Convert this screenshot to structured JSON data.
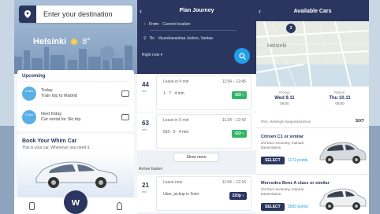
{
  "home": {
    "destination_placeholder": "Enter your destination",
    "city": "Helsinki",
    "temperature": "8°",
    "upcoming": {
      "title": "Upcoming",
      "items": [
        {
          "date": "2 Nov",
          "day": "Today",
          "text": "Train trip to Madrid"
        },
        {
          "date": "2 Nov",
          "day": "Next friday",
          "text": "Car rental for Ski trip"
        }
      ]
    },
    "book": {
      "title": "Book Your Whim Car",
      "subtitle": "This is your car, Whenever you need it."
    },
    "tabbar": {
      "center_label": "w"
    }
  },
  "plan": {
    "title": "Plan Journey",
    "from_label": "From:",
    "from_value": "Current location",
    "to_label": "To:",
    "to_value": "Vauxxkasashaa Jarkoo, Vantaa",
    "time_label": "Right now",
    "trips": [
      {
        "duration": "44",
        "unit": "min",
        "leave": "Leave in 4 min",
        "times": "11:54 – 12:45",
        "legs": "1 · 7 · 4 min",
        "action": "GO"
      },
      {
        "duration": "63",
        "unit": "min",
        "leave": "Leave in 5 min",
        "times": "11:24 – 12:42",
        "legs": "633 · 5 · 4 min",
        "action": "GO"
      }
    ],
    "show_more": "Show more",
    "active_label": "Arrive faster:",
    "active_trip": {
      "duration": "21",
      "unit": "min",
      "leave": "Leave now",
      "times": "11:54 – 12:16",
      "legs": "Uber, pickup in 5min",
      "action": "220p"
    }
  },
  "cars": {
    "title": "Available Cars",
    "map_city": "Helsinki",
    "map_pin": "3",
    "pickup": {
      "label": "Pickup",
      "date": "Wed 9.11",
      "time": "09:00"
    },
    "return": {
      "label": "Return",
      "date": "Thu 10.11",
      "time": "09:00"
    },
    "location_line": "Pick, Helsingin kaupunkisoimus",
    "vendor": "SIXT",
    "list": [
      {
        "name": "Citroen C1 or similar",
        "desc": "2/4 Door economy, manual transmission",
        "button": "SELECT",
        "points": "1172 points"
      },
      {
        "name": "Mercedes Benz A class or similar",
        "desc": "2/4 Door economy, manual transmission",
        "button": "SELECT",
        "points": "3500 points"
      }
    ]
  },
  "colors": {
    "navy": "#2b3660",
    "accent": "#1fa0e8",
    "go": "#33b56a"
  }
}
